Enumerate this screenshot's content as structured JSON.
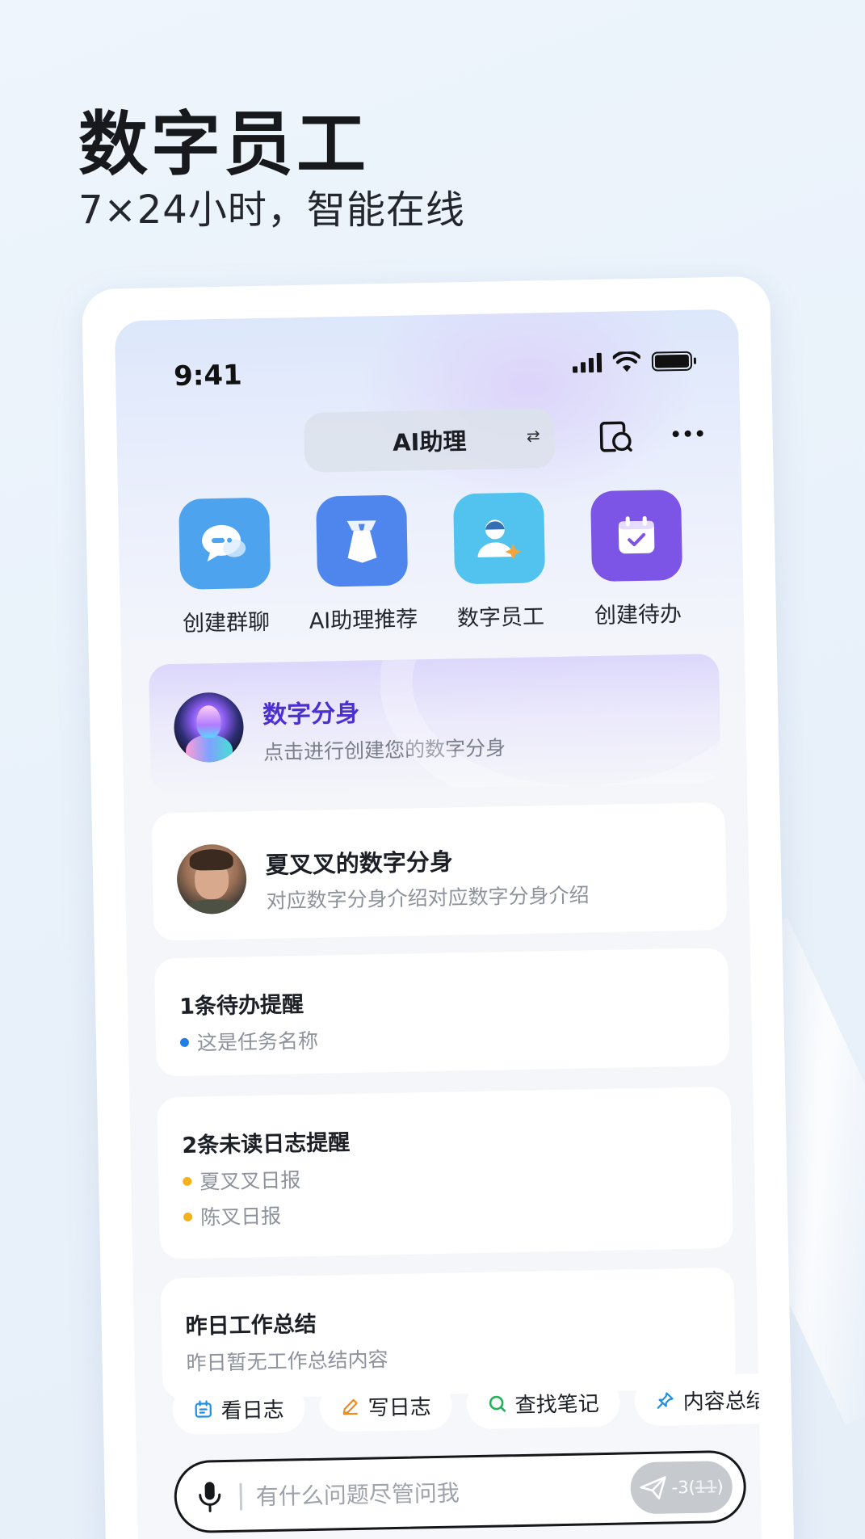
{
  "hero": {
    "title": "数字员工",
    "subtitle": "7×24小时，智能在线"
  },
  "status_bar": {
    "time": "9:41"
  },
  "header": {
    "switcher_label": "AI助理",
    "switch_glyph": "⇄",
    "actions": [
      "chat-history-icon",
      "more-icon"
    ]
  },
  "quick_actions": [
    {
      "label": "创建群聊",
      "icon": "chat-bubble-icon",
      "color": "#4ea3ef"
    },
    {
      "label": "AI助理推荐",
      "icon": "tie-icon",
      "color": "#4e86ee"
    },
    {
      "label": "数字员工",
      "icon": "employee-icon",
      "color": "#52c3ef"
    },
    {
      "label": "创建待办",
      "icon": "calendar-check-icon",
      "color": "#7c54e6"
    }
  ],
  "clone_banner": {
    "title": "数字分身",
    "subtitle": "点击进行创建您的数字分身"
  },
  "person_card": {
    "name": "夏叉叉的数字分身",
    "description": "对应数字分身介绍对应数字分身介绍"
  },
  "todo_card": {
    "title": "1条待办提醒",
    "items": [
      "这是任务名称"
    ],
    "dot_color": "#1f7fe6"
  },
  "notice_card": {
    "title": "2条未读日志提醒",
    "items": [
      "夏叉叉日报",
      "陈叉日报"
    ],
    "dot_color": "#f3b21c"
  },
  "summary_card": {
    "title": "昨日工作总结",
    "content": "昨日暂无工作总结内容"
  },
  "chips": [
    {
      "label": "看日志",
      "icon": "calendar-icon",
      "color": "#1f8fe6"
    },
    {
      "label": "写日志",
      "icon": "pencil-icon",
      "color": "#f08a1c"
    },
    {
      "label": "查找笔记",
      "icon": "search-icon",
      "color": "#22b259"
    },
    {
      "label": "内容总结",
      "icon": "pin-icon",
      "color": "#1f8fe6"
    }
  ],
  "input": {
    "placeholder": "有什么问题尽管问我",
    "count_prefix": "-3",
    "count_struck": "11"
  }
}
